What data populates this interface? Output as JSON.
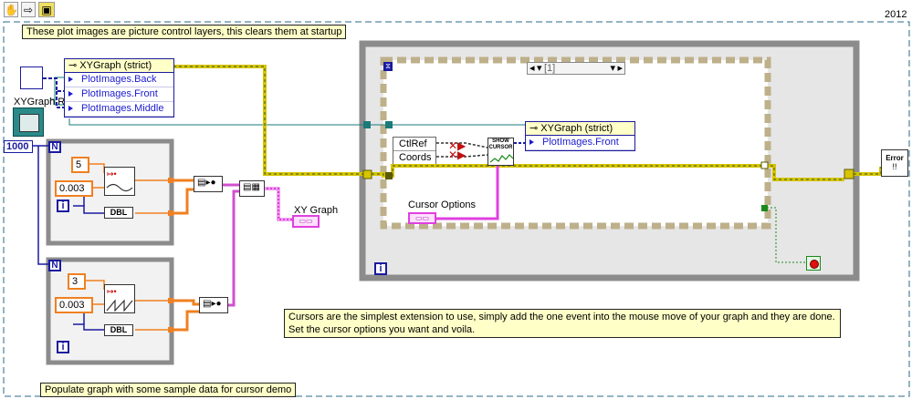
{
  "toolbar": {
    "pan_icon": "hand-icon",
    "step_icon": "arrow-icon",
    "vi_icon": "vi-icon"
  },
  "diagram": {
    "version_label": "2012",
    "note_top": "These plot images are picture control layers, this clears them at startup",
    "note_cursor": "Cursors are the simplest extension to use, simply add the one event into the mouse move of your graph and they are done.  Set the cursor options you want and voila.",
    "note_bottom": "Populate graph with some sample data for cursor demo",
    "xy_ref_label": "XYGraph Re",
    "property_node_1": {
      "title": "XYGraph (strict)",
      "items": [
        "PlotImages.Back",
        "PlotImages.Front",
        "PlotImages.Middle"
      ]
    },
    "property_node_2": {
      "title": "XYGraph (strict)",
      "items": [
        "PlotImages.Front"
      ]
    },
    "loop_count": "1000",
    "loop_n_label": "N",
    "loop_i_label": "i",
    "const_freq_1": "5",
    "const_amp_1": "0.003",
    "const_freq_2": "3",
    "const_amp_2": "0.003",
    "dbl_label": "DBL",
    "xy_graph_label": "XY Graph",
    "event_case": "[1]",
    "event_terms": [
      "CtlRef",
      "Coords"
    ],
    "show_cursor_label": "SHOW CURSOR",
    "cursor_options_label": "Cursor Options",
    "error_label": "Error"
  }
}
